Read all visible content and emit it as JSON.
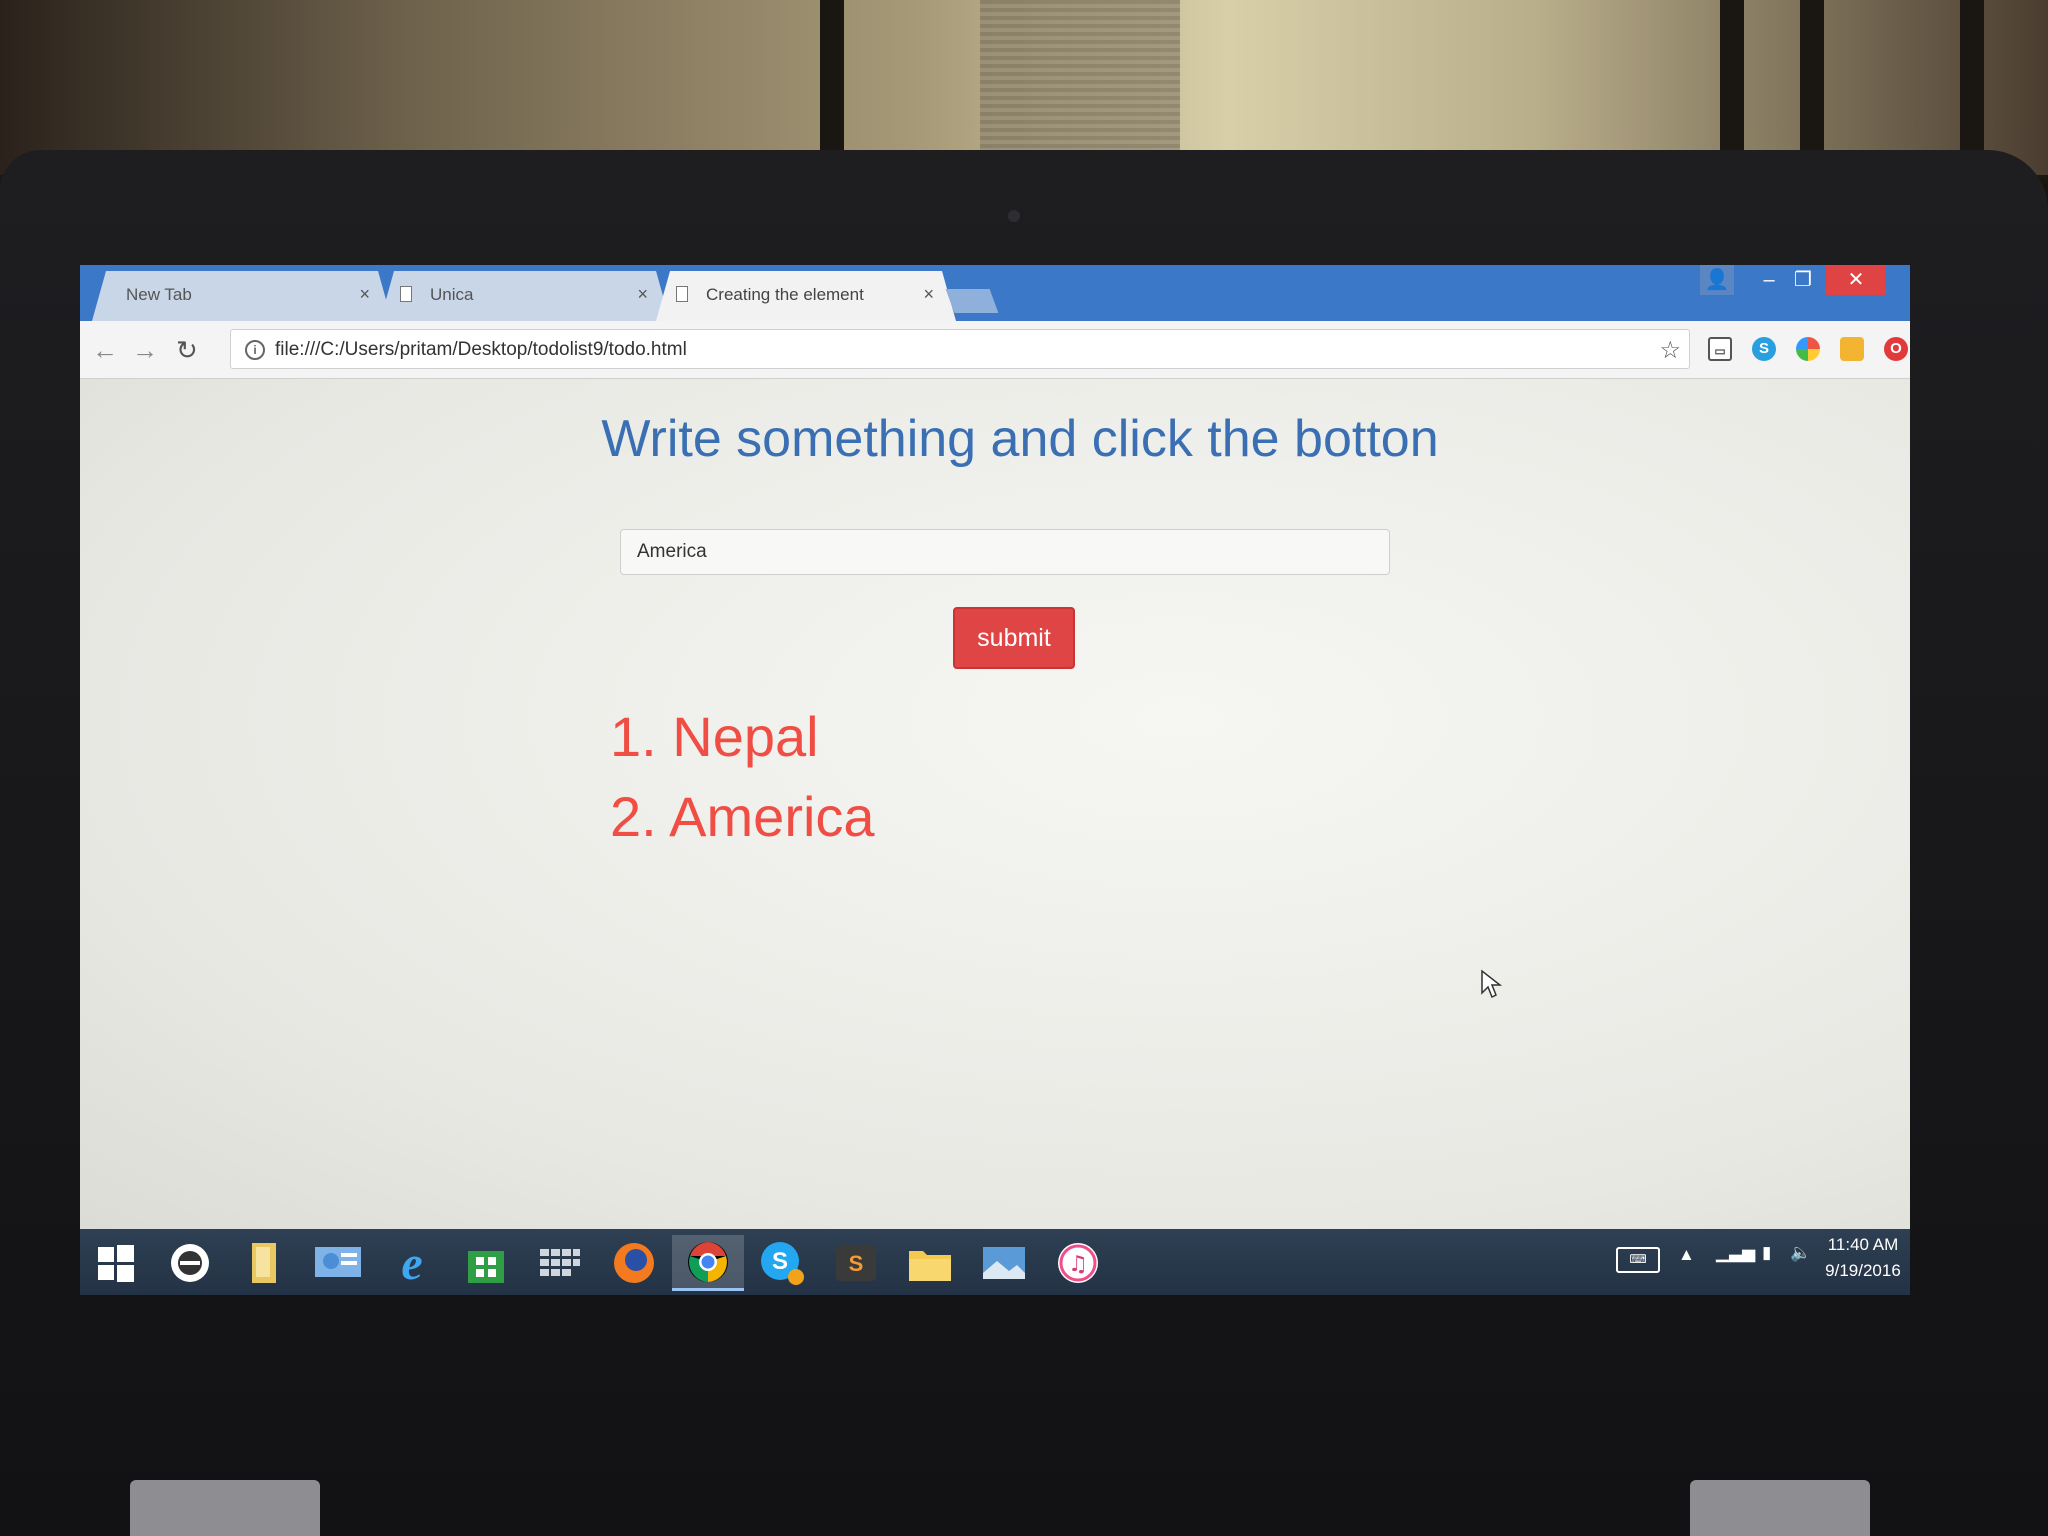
{
  "browser": {
    "tabs": [
      {
        "label": "New Tab",
        "active": false
      },
      {
        "label": "Unica",
        "active": false
      },
      {
        "label": "Creating the element",
        "active": true
      }
    ],
    "address": "file:///C:/Users/pritam/Desktop/todolist9/todo.html"
  },
  "page": {
    "title": "Write something and click the botton",
    "input_value": "America",
    "submit_label": "submit",
    "items": [
      "1. Nepal",
      "2. America"
    ]
  },
  "taskbar": {
    "apps": [
      "windows-start",
      "cortana",
      "file-explorer",
      "control-panel",
      "internet-explorer",
      "store",
      "app-grid",
      "firefox",
      "chrome",
      "skype",
      "sublime-text",
      "folder",
      "photos",
      "itunes"
    ],
    "active_app": "chrome",
    "clock_time": "11:40 AM",
    "clock_date": "9/19/2016"
  },
  "colors": {
    "title": "#3a6fb3",
    "submit": "#e04545",
    "list_text": "#f04e45",
    "tabstrip": "#3c78c8"
  }
}
